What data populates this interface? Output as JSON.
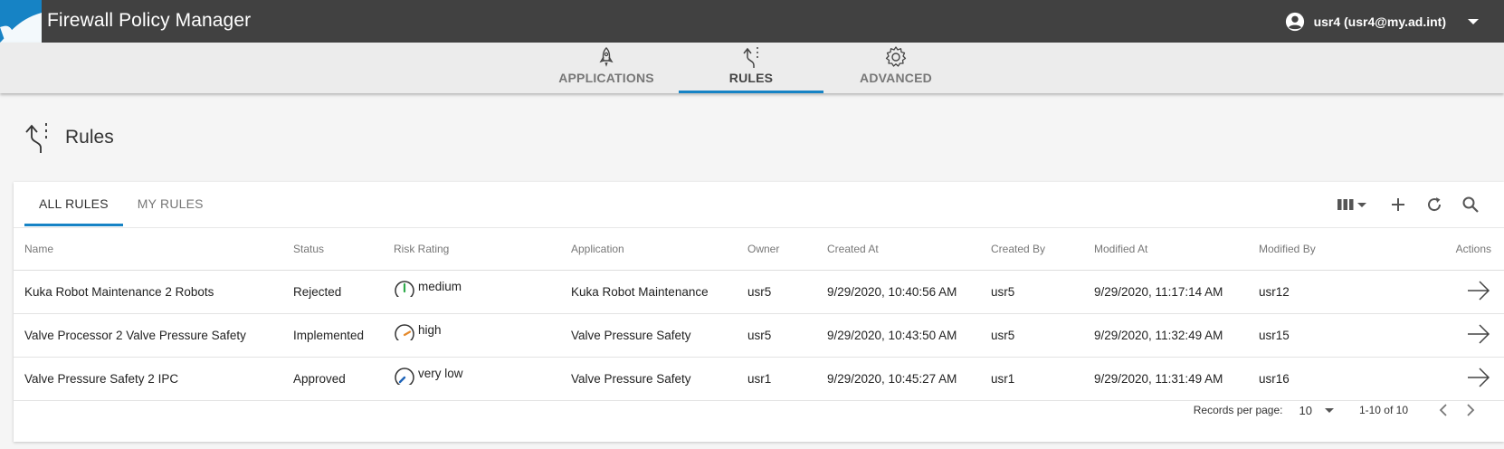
{
  "header": {
    "title": "Firewall Policy Manager",
    "user_label": "usr4 (usr4@my.ad.int)",
    "brand_color": "#1683c5"
  },
  "nav": {
    "tabs": [
      {
        "label": "APPLICATIONS",
        "icon": "rocket-icon",
        "active": false
      },
      {
        "label": "RULES",
        "icon": "rules-fork-icon",
        "active": true
      },
      {
        "label": "ADVANCED",
        "icon": "gear-icon",
        "active": false
      }
    ]
  },
  "page": {
    "title": "Rules",
    "icon": "rules-fork-icon"
  },
  "subtabs": [
    {
      "label": "ALL RULES",
      "active": true
    },
    {
      "label": "MY RULES",
      "active": false
    }
  ],
  "toolbar": {
    "icons": [
      "columns-icon",
      "add-icon",
      "refresh-icon",
      "search-icon"
    ]
  },
  "table": {
    "columns": [
      "Name",
      "Status",
      "Risk Rating",
      "Application",
      "Owner",
      "Created At",
      "Created By",
      "Modified At",
      "Modified By",
      "Actions"
    ],
    "rows": [
      {
        "name": "Kuka Robot Maintenance 2 Robots",
        "status": "Rejected",
        "risk": "medium",
        "risk_color": "#2eaa4a",
        "application": "Kuka Robot Maintenance",
        "owner": "usr5",
        "created_at": "9/29/2020, 10:40:56 AM",
        "created_by": "usr5",
        "modified_at": "9/29/2020, 11:17:14 AM",
        "modified_by": "usr12"
      },
      {
        "name": "Valve Processor 2 Valve Pressure Safety",
        "status": "Implemented",
        "risk": "high",
        "risk_color": "#e58a2c",
        "application": "Valve Pressure Safety",
        "owner": "usr5",
        "created_at": "9/29/2020, 10:43:50 AM",
        "created_by": "usr5",
        "modified_at": "9/29/2020, 11:32:49 AM",
        "modified_by": "usr15"
      },
      {
        "name": "Valve Pressure Safety 2 IPC",
        "status": "Approved",
        "risk": "very low",
        "risk_color": "#1d63b8",
        "application": "Valve Pressure Safety",
        "owner": "usr1",
        "created_at": "9/29/2020, 10:45:27 AM",
        "created_by": "usr1",
        "modified_at": "9/29/2020, 11:31:49 AM",
        "modified_by": "usr16"
      }
    ]
  },
  "pagination": {
    "records_per_page_label": "Records per page:",
    "records_per_page": "10",
    "range": "1-10 of 10"
  }
}
